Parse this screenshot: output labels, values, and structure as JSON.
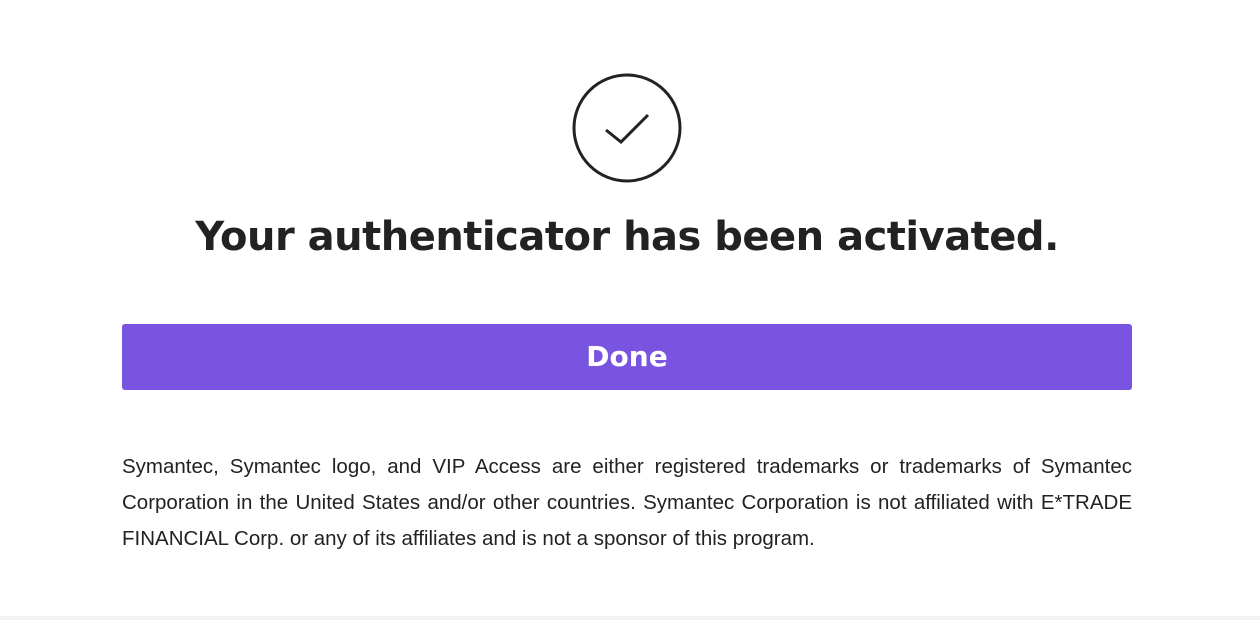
{
  "success": {
    "icon": "checkmark-circle-icon",
    "title": "Your authenticator has been activated."
  },
  "actions": {
    "done_label": "Done"
  },
  "footer": {
    "disclaimer": "Symantec, Symantec logo, and VIP Access are either registered trademarks or trademarks of Symantec Corporation in the United States and/or other countries. Symantec Corporation is not affiliated with E*TRADE FINANCIAL Corp. or any of its affiliates and is not a sponsor of this program."
  },
  "colors": {
    "accent": "#7854e0",
    "text": "#222222",
    "background": "#ffffff"
  }
}
